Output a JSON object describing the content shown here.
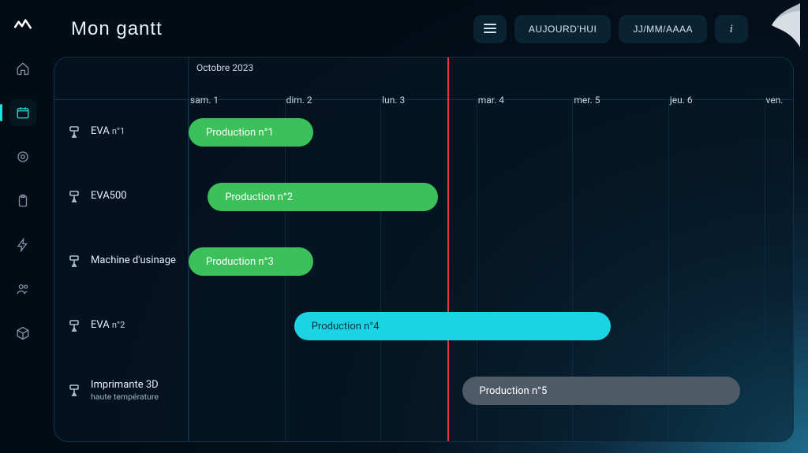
{
  "page": {
    "title": "Mon gantt"
  },
  "header": {
    "today_label": "AUJOURD'HUI",
    "date_format_label": "JJ/MM/AAAA"
  },
  "sidebar": {
    "items": [
      {
        "name": "home"
      },
      {
        "name": "calendar"
      },
      {
        "name": "target"
      },
      {
        "name": "clipboard"
      },
      {
        "name": "bolt"
      },
      {
        "name": "users"
      },
      {
        "name": "cube"
      }
    ],
    "active": "calendar"
  },
  "gantt": {
    "month_label": "Octobre 2023",
    "days": [
      {
        "label": "sam. 1"
      },
      {
        "label": "dim. 2"
      },
      {
        "label": "lun. 3"
      },
      {
        "label": "mar. 4"
      },
      {
        "label": "mer. 5"
      },
      {
        "label": "jeu. 6"
      },
      {
        "label": "ven."
      }
    ],
    "day_count_visible": 6.3,
    "today_fraction": 2.7,
    "rows": [
      {
        "machine": "EVA",
        "machine_suffix": "n°1",
        "bars": [
          {
            "label": "Production n°1",
            "start": 0,
            "span": 1.3,
            "color": "green"
          }
        ]
      },
      {
        "machine": "EVA500",
        "machine_suffix": "",
        "bars": [
          {
            "label": "Production n°2",
            "start": 0.2,
            "span": 2.4,
            "color": "green"
          }
        ]
      },
      {
        "machine": "Machine d'usinage",
        "machine_suffix": "",
        "bars": [
          {
            "label": "Production n°3",
            "start": 0,
            "span": 1.3,
            "color": "green"
          }
        ]
      },
      {
        "machine": "EVA",
        "machine_suffix": "n°2",
        "bars": [
          {
            "label": "Production n°4",
            "start": 1.1,
            "span": 3.3,
            "color": "cyan"
          }
        ]
      },
      {
        "machine": "Imprimante 3D",
        "machine_suffix": "haute température",
        "bars": [
          {
            "label": "Production n°5",
            "start": 2.85,
            "span": 2.9,
            "color": "grey"
          }
        ]
      }
    ]
  }
}
